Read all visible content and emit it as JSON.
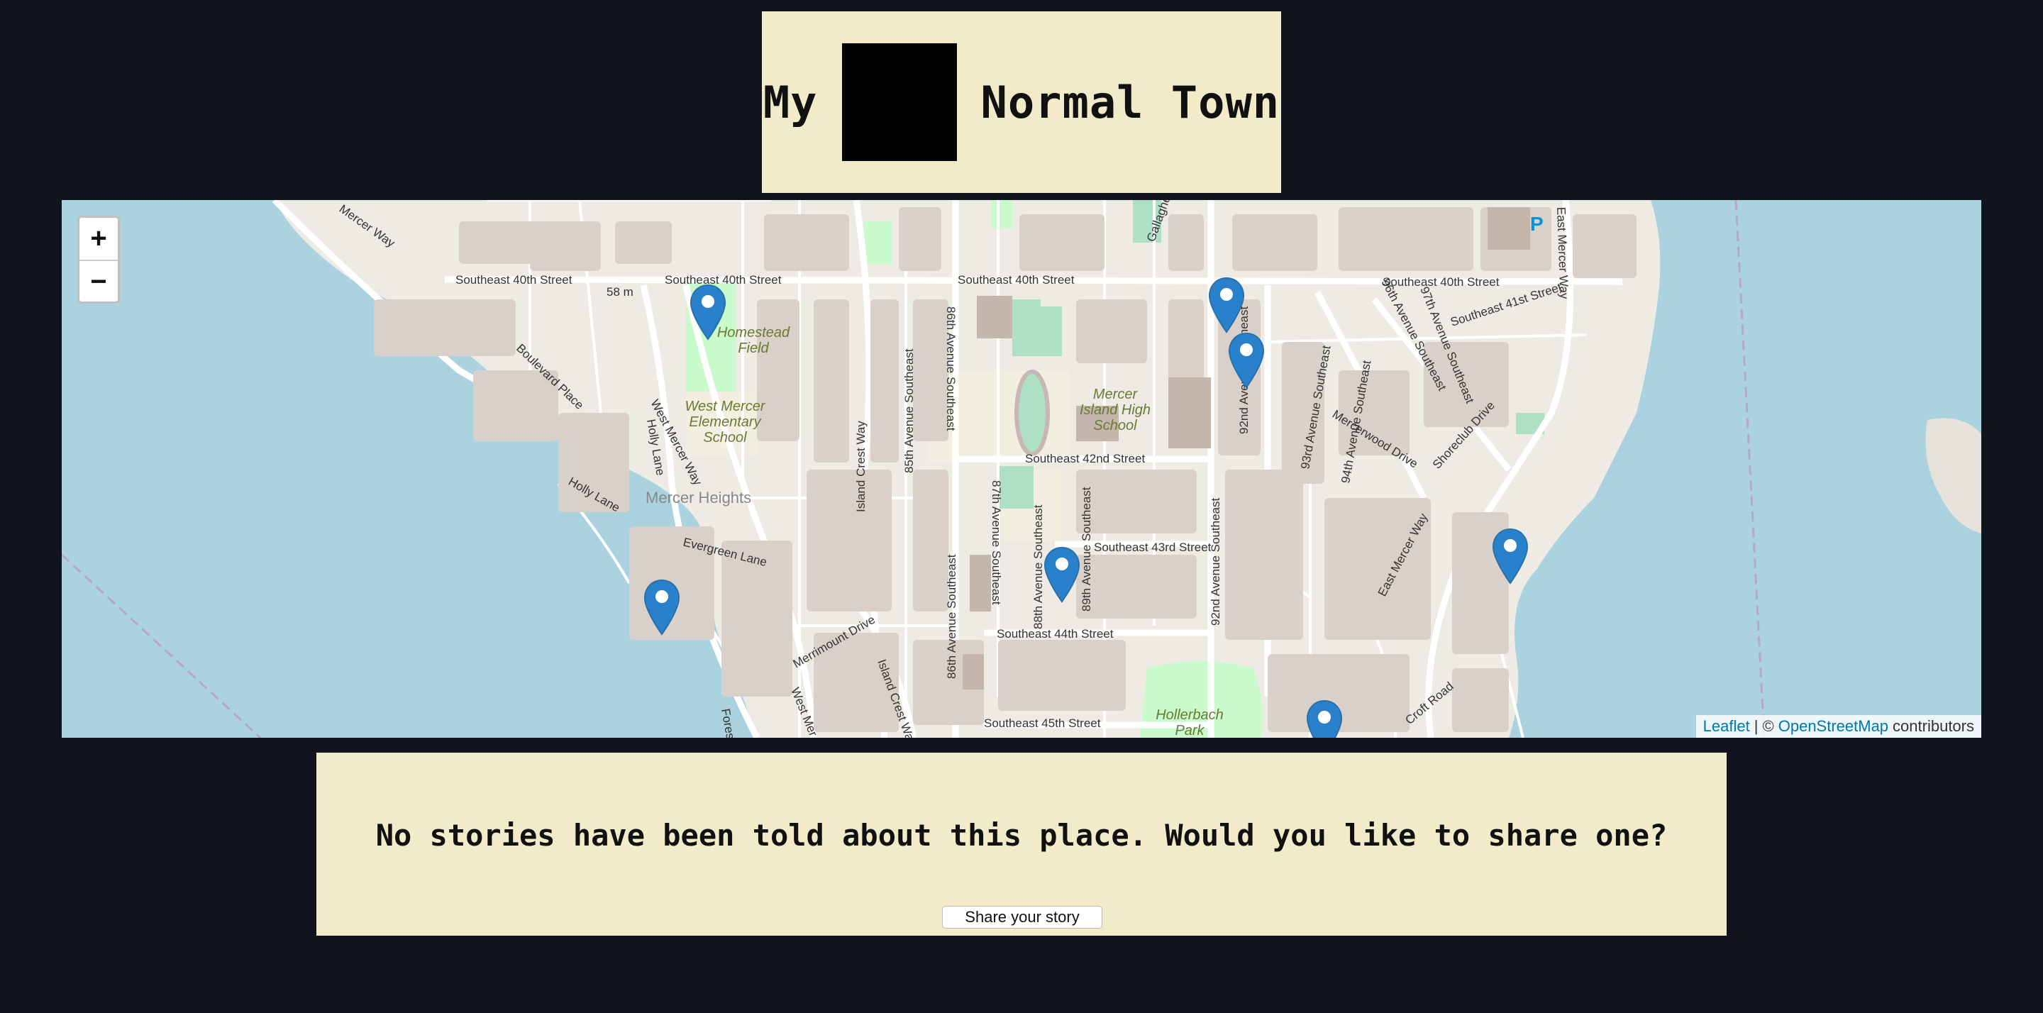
{
  "header": {
    "title_left": "My",
    "title_right": "Normal Town"
  },
  "map": {
    "zoom_in": "+",
    "zoom_out": "−",
    "attribution": {
      "leaflet": "Leaflet",
      "sep": "| ©",
      "osm": "OpenStreetMap",
      "contributors": "contributors"
    },
    "labels": {
      "se40_a": "Southeast 40th Street",
      "se40_b": "Southeast 40th Street",
      "se40_c": "Southeast 40th Street",
      "se40_d": "Southeast 40th Street",
      "se41": "Southeast 41st Street",
      "se42": "Southeast 42nd Street",
      "se43": "Southeast 43rd Street",
      "se44": "Southeast 44th Street",
      "se45": "Southeast 45th Street",
      "w_mercer_way": "West Mercer Way",
      "e_mercer_way": "East Mercer Way",
      "east_mercer_way_top": "East Mercer Way",
      "mercer_way_top": "Mercer Way",
      "island_crest": "Island Crest Way",
      "island_crest_b": "Island Crest Way",
      "ave85": "85th Avenue Southeast",
      "ave86": "86th Avenue Southeast",
      "ave86b": "86th Avenue Southeast",
      "ave87": "87th Avenue Southeast",
      "ave88": "88th Avenue Southeast",
      "ave89": "89th Avenue Southeast",
      "ave92": "92nd Avenue Southeast",
      "ave92b": "92nd Avenue Southeast",
      "ave93": "93rd Avenue Southeast",
      "ave94": "94th Avenue Southeast",
      "ave96": "96th Avenue Southeast",
      "ave97": "97th Avenue Southeast",
      "mercerwood": "Mercerwood Drive",
      "shoreclub": "Shoreclub Drive",
      "boulevard": "Boulevard Place",
      "holly": "Holly Lane",
      "holly_lane2": "Holly Lane",
      "evergreen": "Evergreen Lane",
      "merrimount": "Merrimount Drive",
      "forest": "Forest",
      "west_mer": "West Mer",
      "croft": "Croft Road",
      "gallagher": "Gallagher",
      "elev": "58 m",
      "parking": "P"
    },
    "places": {
      "homestead": [
        "Homestead",
        "Field"
      ],
      "westmercer": [
        "West Mercer",
        "Elementary",
        "School"
      ],
      "mihs": [
        "Mercer",
        "Island High",
        "School"
      ],
      "hollerbach": [
        "Hollerbach",
        "Park"
      ],
      "mercer_heights": "Mercer Heights"
    }
  },
  "story": {
    "message": "No stories have been told about this place. Would you like to share one?",
    "share_button": "Share your story"
  },
  "colors": {
    "background": "#11141c",
    "panel": "#f1ebca",
    "water": "#aad3df",
    "marker": "#2a81cb"
  }
}
